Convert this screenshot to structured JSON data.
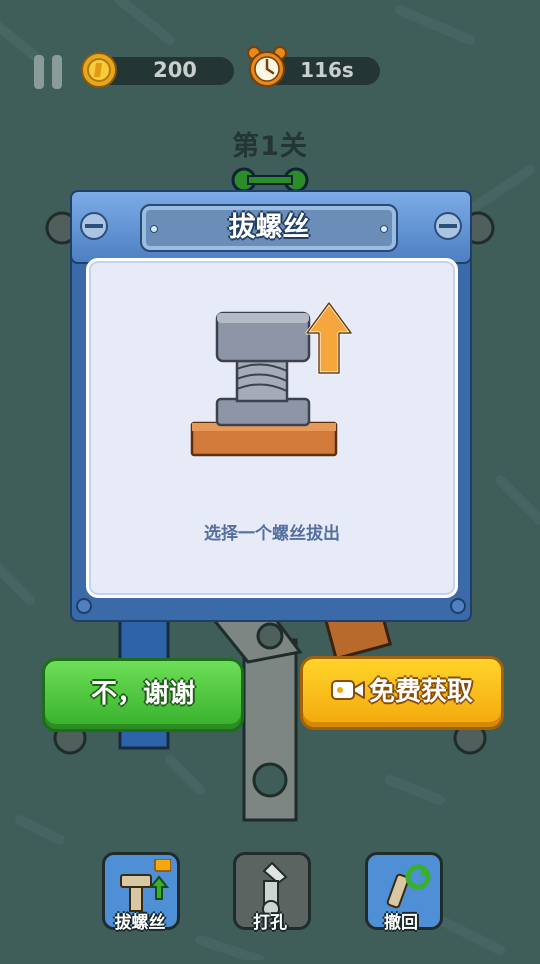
{
  "hud": {
    "coins": "200",
    "timer": "116s"
  },
  "level": {
    "title": "第1关"
  },
  "dialog": {
    "title": "拔螺丝",
    "description": "选择一个螺丝拔出"
  },
  "buttons": {
    "no_thanks": "不，谢谢",
    "free_get": "免费获取"
  },
  "tools": [
    {
      "label": "拔螺丝",
      "icon": "pull-screw-icon"
    },
    {
      "label": "打孔",
      "icon": "drill-icon"
    },
    {
      "label": "撤回",
      "icon": "undo-icon"
    }
  ],
  "colors": {
    "background": "#3f5d59",
    "dialog_blue": "#3a6aa8",
    "green_button": "#37b02c",
    "yellow_button": "#f3a80c"
  }
}
